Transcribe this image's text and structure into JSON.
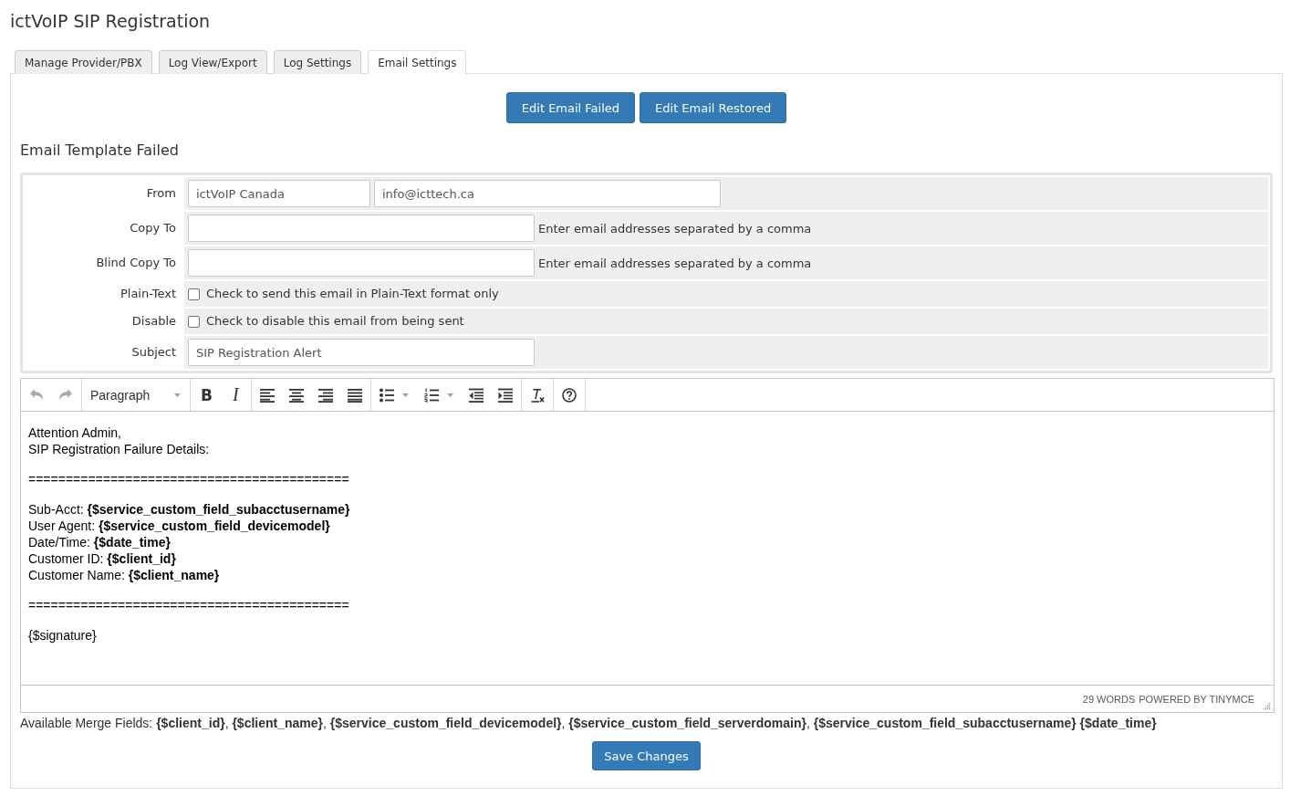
{
  "page": {
    "title": "ictVoIP SIP Registration"
  },
  "tabs": [
    {
      "label": "Manage Provider/PBX",
      "selected": false
    },
    {
      "label": "Log View/Export",
      "selected": false
    },
    {
      "label": "Log Settings",
      "selected": false
    },
    {
      "label": "Email Settings",
      "selected": true
    }
  ],
  "template_buttons": [
    {
      "label": "Edit Email Failed"
    },
    {
      "label": "Edit Email Restored"
    }
  ],
  "section_title": "Email Template Failed",
  "form": {
    "rows": [
      {
        "kind": "sender",
        "label": "From",
        "name": "ictVoIP Canada",
        "email": "info@icttech.ca"
      },
      {
        "kind": "address",
        "label": "Copy To",
        "hint": "Enter email addresses separated by a comma"
      },
      {
        "kind": "address",
        "label": "Blind Copy To",
        "hint": "Enter email addresses separated by a comma"
      },
      {
        "kind": "checkbox",
        "label": "Plain-Text",
        "text": "Check to send this email in Plain-Text format only",
        "checked": false
      },
      {
        "kind": "checkbox",
        "label": "Disable",
        "text": "Check to disable this email from being sent",
        "checked": false
      },
      {
        "kind": "text",
        "label": "Subject",
        "value": "SIP Registration Alert"
      }
    ]
  },
  "editor": {
    "toolbar": [
      {
        "tools": [
          {
            "kind": "undo",
            "disabled": true
          },
          {
            "kind": "redo",
            "disabled": true
          }
        ]
      },
      {
        "tools": [
          {
            "kind": "select",
            "label": "Paragraph",
            "disabled": false
          }
        ]
      },
      {
        "tools": [
          {
            "kind": "bold",
            "label": "B",
            "disabled": false
          },
          {
            "kind": "italic",
            "label": "I",
            "disabled": false
          }
        ]
      },
      {
        "tools": [
          {
            "kind": "alignleft",
            "disabled": false
          },
          {
            "kind": "aligncenter",
            "disabled": false
          },
          {
            "kind": "alignright",
            "disabled": false
          },
          {
            "kind": "justify",
            "disabled": false
          }
        ]
      },
      {
        "tools": [
          {
            "kind": "bullist",
            "disabled": false
          },
          {
            "kind": "numlist",
            "disabled": false
          },
          {
            "kind": "outdent",
            "disabled": false
          },
          {
            "kind": "indent",
            "disabled": false
          }
        ]
      },
      {
        "tools": [
          {
            "kind": "removeformat",
            "disabled": false
          }
        ]
      },
      {
        "tools": [
          {
            "kind": "help",
            "disabled": false
          }
        ]
      }
    ],
    "content": [
      {
        "lines": [
          "Attention Admin,",
          "SIP Registration Failure Details:"
        ]
      },
      {
        "lines": [
          "==========================================="
        ]
      },
      {
        "lines": [
          "Sub-Acct: **{$service_custom_field_subacctusername}**",
          "User Agent: **{$service_custom_field_devicemodel}**",
          "Date/Time: **{$date_time}**",
          "Customer ID: **{$client_id}**",
          "Customer Name: **{$client_name}**"
        ]
      },
      {
        "lines": [
          "==========================================="
        ]
      },
      {
        "lines": [
          "{$signature}"
        ]
      }
    ],
    "status": {
      "word_count": "29 WORDS",
      "branding": "POWERED BY TINYMCE"
    }
  },
  "merge_fields": "Available Merge Fields: **{$client_id}**, **{$client_name}**, **{$service_custom_field_devicemodel}**, **{$service_custom_field_serverdomain}**, **{$service_custom_field_subacctusername}** **{$date_time}**",
  "save_button": "Save Changes"
}
